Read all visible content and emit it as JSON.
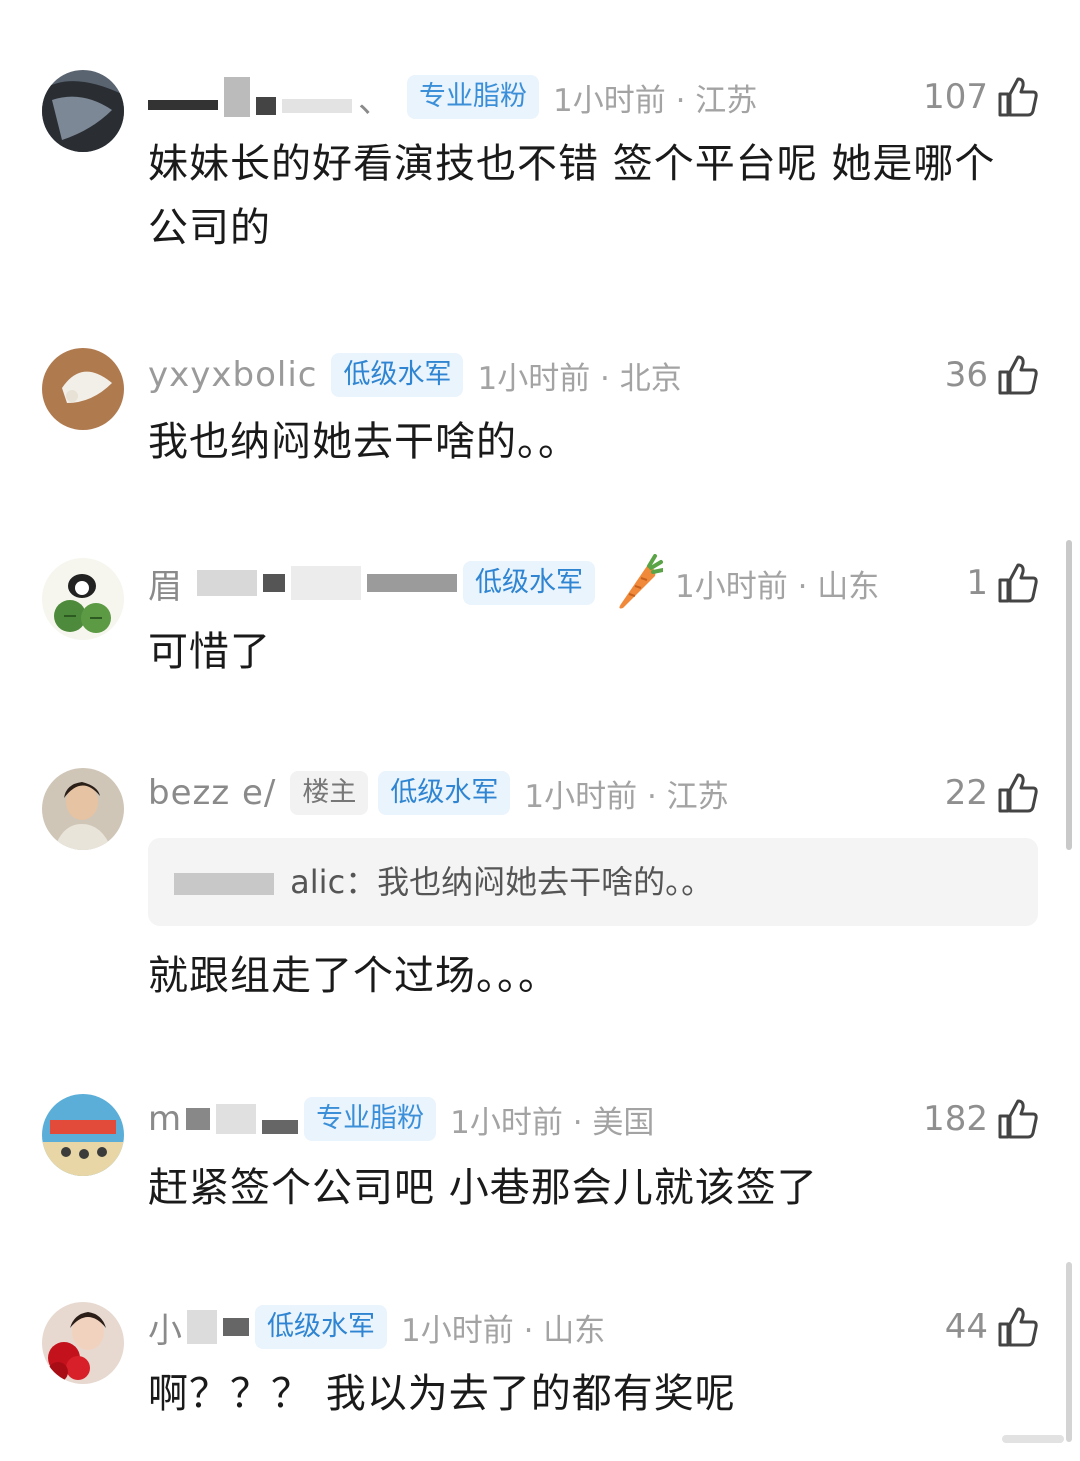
{
  "comments": [
    {
      "username_visible": "、",
      "badge": "专业脂粉",
      "time": "1小时前 · 江苏",
      "likes": "107",
      "text": "妹妹长的好看演技也不错 签个平台呢 她是哪个公司的"
    },
    {
      "username_visible": "yxyxbolic",
      "badge": "低级水军",
      "time": "1小时前 · 北京",
      "likes": "36",
      "text": "我也纳闷她去干啥的。。"
    },
    {
      "username_visible": "眉",
      "badge": "低级水军",
      "time": "1小时前 · 山东",
      "likes": "1",
      "text": "可惜了",
      "emblem": "carrot-icon"
    },
    {
      "username_visible": "bezz e/",
      "owner_badge": "楼主",
      "badge": "低级水军",
      "time": "1小时前 · 江苏",
      "likes": "22",
      "quote": "alic：我也纳闷她去干啥的。。",
      "text": "就跟组走了个过场。。。"
    },
    {
      "username_visible": "m",
      "badge": "专业脂粉",
      "time": "1小时前 · 美国",
      "likes": "182",
      "text": "赶紧签个公司吧 小巷那会儿就该签了"
    },
    {
      "username_visible": "小",
      "badge": "低级水军",
      "time": "1小时前 · 山东",
      "likes": "44",
      "text": "啊？？？ 我以为去了的都有奖呢"
    }
  ],
  "colors": {
    "badge_text": "#3a8fd8",
    "badge_bg": "#eaf4fd",
    "meta_gray": "#a3a3a3",
    "body_text": "#1a1a1a"
  }
}
